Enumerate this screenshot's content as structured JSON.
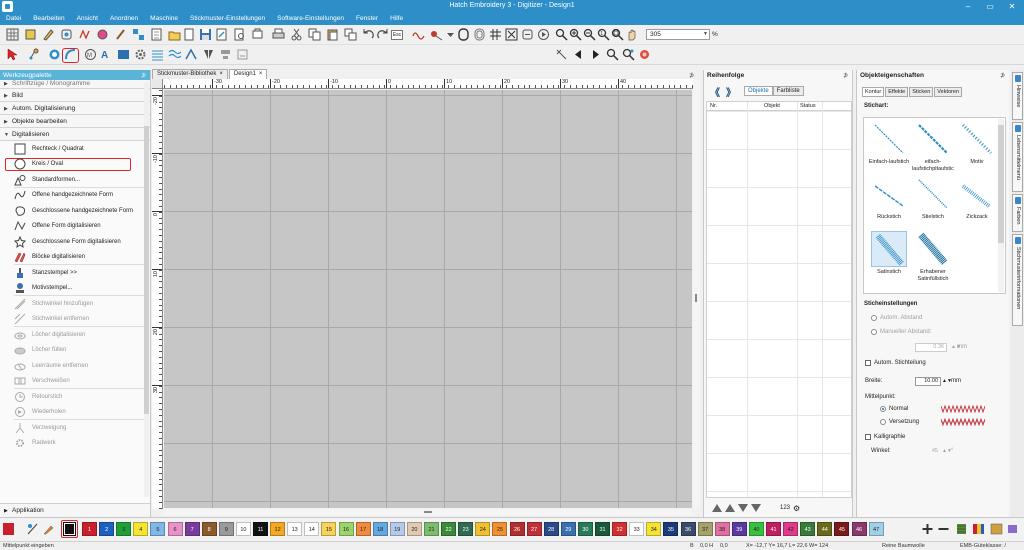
{
  "window": {
    "title": "Hatch Embroidery 3 - Digitizer - Design1"
  },
  "menu": [
    "Datei",
    "Bearbeiten",
    "Ansicht",
    "Anordnen",
    "Maschine",
    "Stickmuster-Einstellungen",
    "Software-Einstellungen",
    "Fenster",
    "Hilfe"
  ],
  "toolbar": {
    "esc_label": "Esc",
    "zoom_value": "305",
    "zoom_unit": "%"
  },
  "left_panel": {
    "title": "Werkzeugpalette",
    "pin": "⊅",
    "sections": {
      "top_cut": "Schriftzüge / Monogramme",
      "bild": "Bild",
      "auto": "Autom. Digitalisierung",
      "obj": "Objekte bearbeiten",
      "dig": "Digitalisieren",
      "app": "Applikation"
    },
    "tools": [
      {
        "label": "Rechteck / Quadrat",
        "dim": false
      },
      {
        "label": "Kreis / Oval",
        "dim": false
      },
      {
        "label": "Standardformen...",
        "dim": false
      },
      {
        "label": "Offene handgezeichnete Form",
        "dim": false
      },
      {
        "label": "Geschlossene handgezeichnete Form",
        "dim": false
      },
      {
        "label": "Offene Form digitalisieren",
        "dim": false
      },
      {
        "label": "Geschlossene Form digitalisieren",
        "dim": false
      },
      {
        "label": "Blöcke digitalisieren",
        "dim": false
      },
      {
        "label": "Stanzstempel >>",
        "dim": false
      },
      {
        "label": "Motivstempel...",
        "dim": false
      },
      {
        "label": "Stichwinkel hinzufügen",
        "dim": true
      },
      {
        "label": "Stichwinkel entfernen",
        "dim": true
      },
      {
        "label": "Löcher digitalisieren",
        "dim": true
      },
      {
        "label": "Löcher füllen",
        "dim": true
      },
      {
        "label": "Leerräume entfernen",
        "dim": true
      },
      {
        "label": "Verschweißen",
        "dim": true
      },
      {
        "label": "Retourstich",
        "dim": true
      },
      {
        "label": "Wiederholen",
        "dim": true
      },
      {
        "label": "Verzweigung",
        "dim": true
      },
      {
        "label": "Radwerk",
        "dim": true
      }
    ]
  },
  "doc": {
    "tabs": [
      {
        "label": "Stickmuster-Bibliothek",
        "close": "×"
      },
      {
        "label": "Design1",
        "close": "×"
      }
    ],
    "tab_pin": "⊅",
    "ruler_top": [
      "-40",
      "-30",
      "-20",
      "-10",
      "0",
      "10",
      "20",
      "30",
      "40"
    ],
    "ruler_left": [
      "-30",
      "-20",
      "-10",
      "0",
      "10",
      "20",
      "30"
    ]
  },
  "seq_panel": {
    "title": "Reihenfolge",
    "pin": "⊅",
    "tabs": [
      "Objekte",
      "Farbliste"
    ],
    "columns": [
      "Nr.",
      "Objekt",
      "Status"
    ],
    "footer_count": "123"
  },
  "prop_panel": {
    "title": "Objekteigenschaften",
    "pin": "⊅",
    "tabs": [
      "Kontur",
      "Effekte",
      "Sticken",
      "Vektoren"
    ],
    "stitch_type_label": "Stichart:",
    "stitch_types": [
      "Einfach-laufstich",
      "eifach-laufstichpltaufstic",
      "Motiv",
      "Rückstich",
      "Stielstich",
      "Zickzack",
      "Satinstich",
      "Erhabener Satinfüllstich"
    ],
    "settings_label": "Sticheinstellungen",
    "auto_spacing": "Autom. Abstand",
    "manual_spacing": "Manueller Abstand:",
    "spacing_value": "0.36",
    "spacing_unit": "mm",
    "auto_split": "Autom. Stichteilung",
    "width_label": "Breite:",
    "width_value": "10.00",
    "width_unit": "mm",
    "center_label": "Mittelpunkt:",
    "center_normal": "Normal",
    "center_offset": "Versetzung",
    "calligraphy": "Kalligraphie",
    "angle_label": "Winkel:",
    "angle_value": "45",
    "angle_unit": "°"
  },
  "dock_tabs": [
    "Hinweise",
    "Lebensmittelmenü",
    "Farben",
    "Stichmusterinformationen"
  ],
  "colorbar": {
    "swatches": [
      {
        "n": "1",
        "c": "#c8202c"
      },
      {
        "n": "2",
        "c": "#1f5fbf"
      },
      {
        "n": "3",
        "c": "#1f9e3a"
      },
      {
        "n": "4",
        "c": "#f5e533"
      },
      {
        "n": "5",
        "c": "#7fb7e6"
      },
      {
        "n": "6",
        "c": "#e991c8"
      },
      {
        "n": "7",
        "c": "#7a3c9c"
      },
      {
        "n": "8",
        "c": "#8b5a2b"
      },
      {
        "n": "9",
        "c": "#9a9a9a"
      },
      {
        "n": "10",
        "c": "#ffffff"
      },
      {
        "n": "11",
        "c": "#111111"
      },
      {
        "n": "12",
        "c": "#f5a623"
      },
      {
        "n": "13",
        "c": "#ffffff"
      },
      {
        "n": "14",
        "c": "#ffffff"
      },
      {
        "n": "15",
        "c": "#f6d35a"
      },
      {
        "n": "16",
        "c": "#9bd46a"
      },
      {
        "n": "17",
        "c": "#f08a3c"
      },
      {
        "n": "18",
        "c": "#63a8e0"
      },
      {
        "n": "19",
        "c": "#b7c9e8"
      },
      {
        "n": "20",
        "c": "#e0c9b0"
      },
      {
        "n": "21",
        "c": "#7cbc6c"
      },
      {
        "n": "22",
        "c": "#3a8a3a"
      },
      {
        "n": "23",
        "c": "#2e6b4f"
      },
      {
        "n": "24",
        "c": "#f0c030"
      },
      {
        "n": "25",
        "c": "#f09030"
      },
      {
        "n": "26",
        "c": "#b03030"
      },
      {
        "n": "27",
        "c": "#c0303a"
      },
      {
        "n": "28",
        "c": "#2a4a8a"
      },
      {
        "n": "29",
        "c": "#3a6fb0"
      },
      {
        "n": "30",
        "c": "#2a7a5a"
      },
      {
        "n": "31",
        "c": "#1a5a3a"
      },
      {
        "n": "32",
        "c": "#d03030"
      },
      {
        "n": "33",
        "c": "#ffffff"
      },
      {
        "n": "34",
        "c": "#f5e533"
      },
      {
        "n": "35",
        "c": "#1a3a7a"
      },
      {
        "n": "36",
        "c": "#3a4a6a"
      },
      {
        "n": "37",
        "c": "#a8a06a"
      },
      {
        "n": "38",
        "c": "#e070a0"
      },
      {
        "n": "39",
        "c": "#5a3aa0"
      },
      {
        "n": "40",
        "c": "#3ac040"
      },
      {
        "n": "41",
        "c": "#c02060"
      },
      {
        "n": "42",
        "c": "#e03a8a"
      },
      {
        "n": "43",
        "c": "#3a7a3a"
      },
      {
        "n": "44",
        "c": "#6a6a1a"
      },
      {
        "n": "45",
        "c": "#7a1a1a"
      },
      {
        "n": "46",
        "c": "#8a3a6a"
      },
      {
        "n": "47",
        "c": "#a0d0e8"
      }
    ]
  },
  "status": {
    "left": "Mittelpunkt eingeben",
    "b": "B",
    "h": "0,0 H",
    "zero": "0,0",
    "coords": "X= -12,7 Y= 16,7 L= 22,6 W= 124",
    "thread": "Reine Baumwolle",
    "quality": "EMB-Güteklasse: /"
  }
}
